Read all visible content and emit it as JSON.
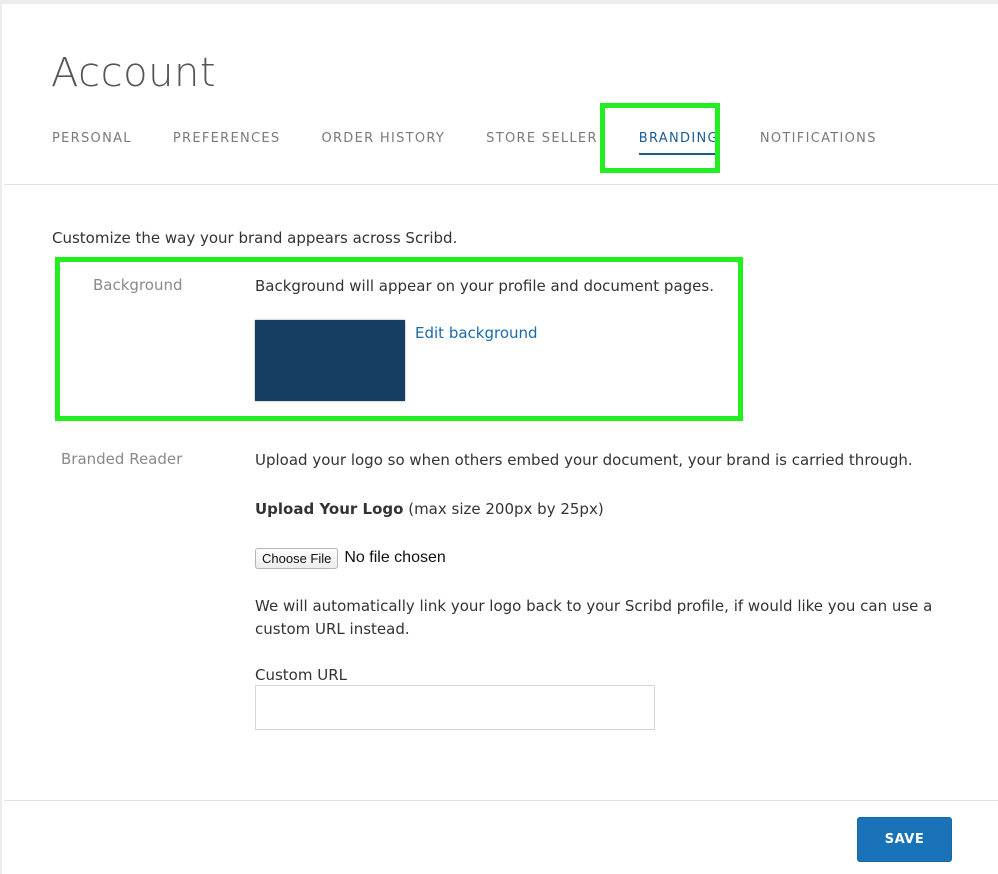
{
  "header": {
    "title": "Account"
  },
  "tabs": [
    {
      "label": "PERSONAL"
    },
    {
      "label": "PREFERENCES"
    },
    {
      "label": "ORDER HISTORY"
    },
    {
      "label": "STORE SELLER"
    },
    {
      "label": "BRANDING",
      "active": true
    },
    {
      "label": "NOTIFICATIONS"
    }
  ],
  "branding": {
    "intro": "Customize the way your brand appears across Scribd.",
    "background": {
      "label": "Background",
      "description": "Background will appear on your profile and document pages.",
      "swatch_color": "#143f62",
      "edit_link": "Edit background"
    },
    "reader": {
      "label": "Branded Reader",
      "description": "Upload your logo so when others embed your document, your brand is carried through.",
      "upload_title": "Upload Your Logo",
      "upload_hint": " (max size 200px by 25px)",
      "choose_file": "Choose File",
      "no_file": "No file chosen",
      "link_note_line1": "We will automatically link your logo back to your Scribd profile, if would like you can use a",
      "link_note_line2": "custom URL instead.",
      "custom_url_label": "Custom URL",
      "custom_url_value": ""
    }
  },
  "footer": {
    "save_label": "SAVE"
  },
  "colors": {
    "accent": "#1a73b8",
    "link": "#1a6aa8",
    "highlight": "#22ee22"
  }
}
